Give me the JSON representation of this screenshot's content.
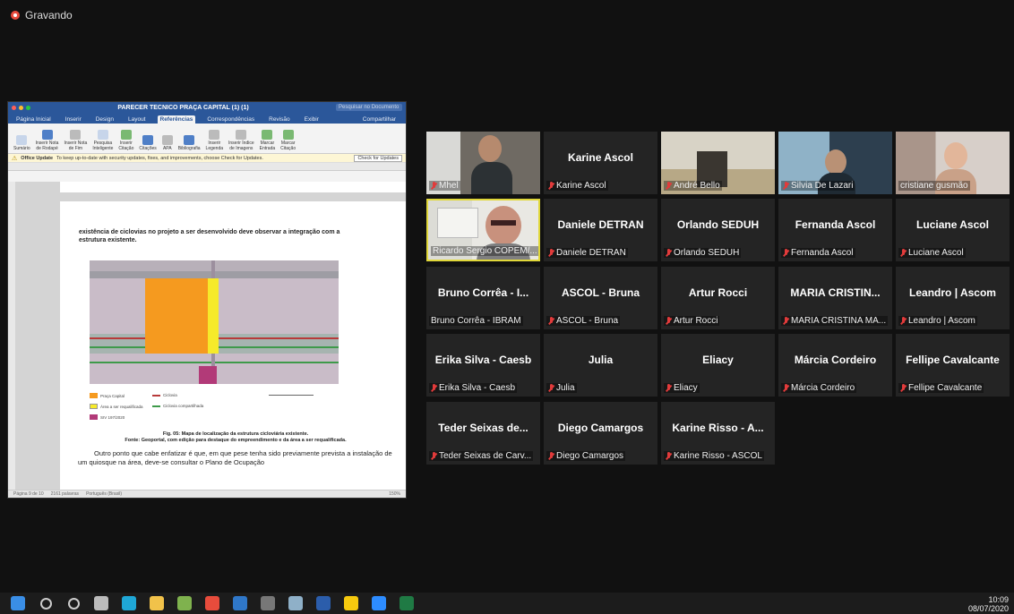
{
  "recording": {
    "label": "Gravando"
  },
  "word": {
    "title": "PARECER TÉCNICO PRAÇA CAPITAL (1) (1)",
    "search_placeholder": "Pesquisar no Documento",
    "tabs": [
      "Página Inicial",
      "Inserir",
      "Design",
      "Layout",
      "Referências",
      "Correspondências",
      "Revisão",
      "Exibir"
    ],
    "active_tab": "Referências",
    "share_label": "Compartilhar",
    "tools": [
      {
        "label1": "Sumário",
        "label2": ""
      },
      {
        "label1": "Inserir Nota",
        "label2": "de Rodapé"
      },
      {
        "label1": "Inserir Nota",
        "label2": "de Fim"
      },
      {
        "label1": "Pesquisa",
        "label2": "Inteligente"
      },
      {
        "label1": "Inserir",
        "label2": "Citação"
      },
      {
        "label1": "Citações",
        "label2": ""
      },
      {
        "label1": "Bibliografia",
        "label2": ""
      },
      {
        "label1": "Inserir",
        "label2": "Legenda"
      },
      {
        "label1": "Inserir Índice",
        "label2": "de Imagens"
      },
      {
        "label1": "Marcar",
        "label2": "Entrada"
      },
      {
        "label1": "Marcar",
        "label2": "Citação"
      }
    ],
    "style_value": "APA",
    "update_bar": {
      "title": "Office Update",
      "message": "To keep up-to-date with security updates, fixes, and improvements, choose Check for Updates.",
      "button": "Check for Updates"
    },
    "text1": "existência de ciclovias no projeto a ser desenvolvido deve observar a integração com a estrutura existente.",
    "legend": {
      "l1": "Praça Capital",
      "l2": "Área a ser requalificada",
      "l3": "SIV 197/2020",
      "r1": "Ciclovia",
      "r2": "Ciclovia compartilhada"
    },
    "caption1": "Fig. 05: Mapa de localização da estrutura cicloviária existente.",
    "caption2": "Fonte: Geoportal, com edição para destaque do empreendimento e da área a ser requalificada.",
    "body2": "Outro ponto que cabe enfatizar é que, em que pese tenha sido previamente prevista a instalação de um quiosque na área, deve-se consultar o Plano de Ocupação",
    "status": {
      "page": "Página 9 de 10",
      "words": "2161 palavras",
      "language": "Português (Brasil)",
      "zoom": "150%"
    }
  },
  "participants": [
    {
      "id": "mhel",
      "name": "",
      "label": "Mhel",
      "muted": true,
      "video": true
    },
    {
      "id": "karine-ascol",
      "name": "Karine Ascol",
      "label": "Karine Ascol",
      "muted": true,
      "video": false
    },
    {
      "id": "andre",
      "name": "",
      "label": "André Bello",
      "muted": true,
      "video": true
    },
    {
      "id": "silvia",
      "name": "",
      "label": "Silvia De Lazari",
      "muted": true,
      "video": true
    },
    {
      "id": "cristiane",
      "name": "",
      "label": "cristiane gusmão",
      "muted": false,
      "video": true
    },
    {
      "id": "ricardo",
      "name": "",
      "label": "Ricardo Sergio COPEM/...",
      "muted": false,
      "video": true
    },
    {
      "id": "daniele",
      "name": "Daniele DETRAN",
      "label": "Daniele DETRAN",
      "muted": true,
      "video": false
    },
    {
      "id": "orlando",
      "name": "Orlando SEDUH",
      "label": "Orlando SEDUH",
      "muted": true,
      "video": false
    },
    {
      "id": "fernanda",
      "name": "Fernanda Ascol",
      "label": "Fernanda Ascol",
      "muted": true,
      "video": false
    },
    {
      "id": "luciane",
      "name": "Luciane Ascol",
      "label": "Luciane Ascol",
      "muted": true,
      "video": false
    },
    {
      "id": "bruno",
      "name": "Bruno Corrêa - I...",
      "label": "Bruno Corrêa - IBRAM",
      "muted": false,
      "video": false
    },
    {
      "id": "bruna",
      "name": "ASCOL - Bruna",
      "label": "ASCOL - Bruna",
      "muted": true,
      "video": false
    },
    {
      "id": "artur",
      "name": "Artur Rocci",
      "label": "Artur Rocci",
      "muted": true,
      "video": false
    },
    {
      "id": "maria",
      "name": "MARIA CRISTIN...",
      "label": "MARIA CRISTINA MA...",
      "muted": true,
      "video": false
    },
    {
      "id": "leandro",
      "name": "Leandro | Ascom",
      "label": "Leandro | Ascom",
      "muted": true,
      "video": false
    },
    {
      "id": "erika",
      "name": "Erika Silva - Caesb",
      "label": "Erika Silva - Caesb",
      "muted": true,
      "video": false
    },
    {
      "id": "julia",
      "name": "Julia",
      "label": "Julia",
      "muted": true,
      "video": false
    },
    {
      "id": "eliacy",
      "name": "Eliacy",
      "label": "Eliacy",
      "muted": true,
      "video": false
    },
    {
      "id": "marcia",
      "name": "Márcia Cordeiro",
      "label": "Márcia Cordeiro",
      "muted": true,
      "video": false
    },
    {
      "id": "fellipe",
      "name": "Fellipe Cavalcante",
      "label": "Fellipe Cavalcante",
      "muted": true,
      "video": false
    },
    {
      "id": "teder",
      "name": "Teder Seixas de...",
      "label": "Teder Seixas de Carv...",
      "muted": true,
      "video": false
    },
    {
      "id": "diego",
      "name": "Diego Camargos",
      "label": "Diego Camargos",
      "muted": true,
      "video": false
    },
    {
      "id": "karine-risso",
      "name": "Karine Risso - A...",
      "label": "Karine Risso - ASCOL",
      "muted": true,
      "video": false
    }
  ],
  "taskbar": {
    "apps": [
      "start-icon",
      "search-icon",
      "cortana-icon",
      "task-view-icon",
      "edge-icon",
      "file-explorer-icon",
      "store-icon",
      "chrome-icon",
      "outlook-icon",
      "steam-icon",
      "app-icon",
      "word-icon",
      "sticky-notes-icon",
      "zoom-icon",
      "excel-icon"
    ],
    "time": "10:09",
    "date": "08/07/2020"
  },
  "colors": {
    "accent_word": "#2b579a",
    "speaker_border": "#e0d73a",
    "mute_red": "#e23b3b"
  }
}
